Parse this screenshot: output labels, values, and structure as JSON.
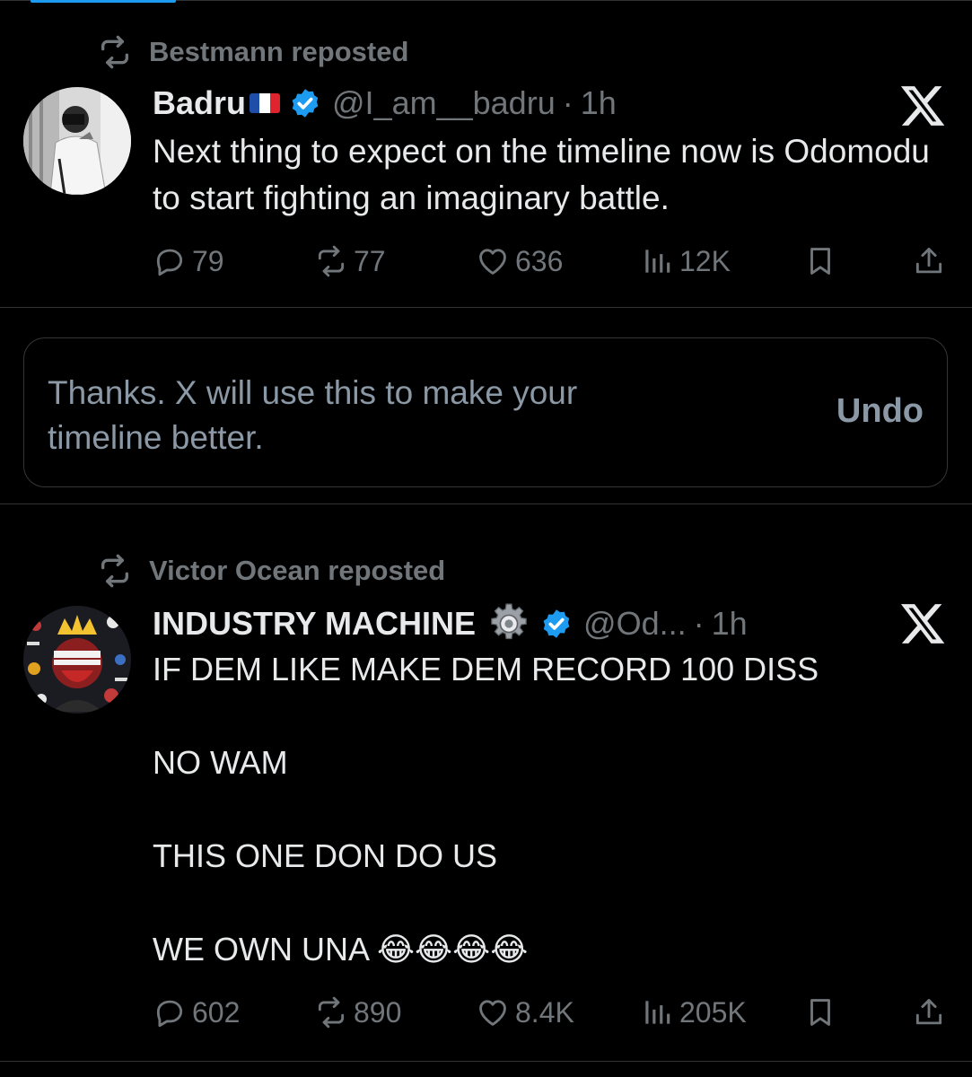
{
  "tweets": [
    {
      "repost_text": "Bestmann reposted",
      "name": "Badru",
      "name_emoji": "french-flag",
      "verified": true,
      "handle": "@I_am__badru",
      "time": "1h",
      "text": "Next thing to expect on the timeline now is Odomodu to start fighting an imaginary battle.",
      "replies": "79",
      "reposts": "77",
      "likes": "636",
      "views": "12K"
    },
    {
      "repost_text": "Victor Ocean reposted",
      "name": "INDUSTRY MACHINE",
      "name_emoji": "gear-icon",
      "verified": true,
      "handle": "@Od...",
      "time": "1h",
      "text": "IF DEM LIKE MAKE DEM RECORD 100 DISS\n\nNO WAM\n\nTHIS ONE DON DO US\n\nWE OWN UNA 😂😂😂😂",
      "replies": "602",
      "reposts": "890",
      "likes": "8.4K",
      "views": "205K"
    }
  ],
  "notice": {
    "text": "Thanks. X will use this to make your timeline better.",
    "undo_label": "Undo"
  },
  "colors": {
    "background": "#000000",
    "text_primary": "#e7e9ea",
    "text_secondary": "#71767b",
    "verified_blue": "#1d9bf0",
    "divider": "#2f3336"
  },
  "dot_separator": "·"
}
